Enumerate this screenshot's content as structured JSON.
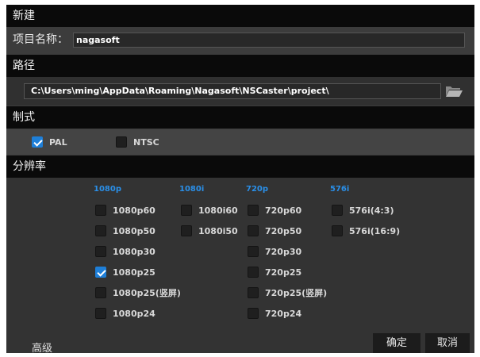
{
  "dialog": {
    "title": "新建"
  },
  "project": {
    "label": "项目名称：",
    "value": "nagasoft"
  },
  "path": {
    "label": "路径",
    "value": "C:\\Users\\ming\\AppData\\Roaming\\Nagasoft\\NSCaster\\project\\",
    "browse_icon": "folder-open-icon"
  },
  "format": {
    "label": "制式",
    "options": [
      {
        "label": "PAL",
        "checked": true
      },
      {
        "label": "NTSC",
        "checked": false
      }
    ]
  },
  "resolution": {
    "label": "分辨率",
    "columns": [
      {
        "header": "1080p",
        "options": [
          {
            "label": "1080p60",
            "checked": false
          },
          {
            "label": "1080p50",
            "checked": false
          },
          {
            "label": "1080p30",
            "checked": false
          },
          {
            "label": "1080p25",
            "checked": true
          },
          {
            "label": "1080p25(竖屏)",
            "checked": false
          },
          {
            "label": "1080p24",
            "checked": false
          }
        ]
      },
      {
        "header": "1080i",
        "options": [
          {
            "label": "1080i60",
            "checked": false
          },
          {
            "label": "1080i50",
            "checked": false
          }
        ]
      },
      {
        "header": "720p",
        "options": [
          {
            "label": "720p60",
            "checked": false
          },
          {
            "label": "720p50",
            "checked": false
          },
          {
            "label": "720p30",
            "checked": false
          },
          {
            "label": "720p25",
            "checked": false
          },
          {
            "label": "720p25(竖屏)",
            "checked": false
          },
          {
            "label": "720p24",
            "checked": false
          }
        ]
      },
      {
        "header": "576i",
        "options": [
          {
            "label": "576i(4:3)",
            "checked": false
          },
          {
            "label": "576i(16:9)",
            "checked": false
          }
        ]
      }
    ]
  },
  "footer": {
    "advanced_label": "高级",
    "ok_label": "确定",
    "cancel_label": "取消"
  },
  "colors": {
    "accent": "#2a8fe8",
    "checkbox_checked": "#1e7fd8",
    "header_bar": "#0a0a0a"
  }
}
